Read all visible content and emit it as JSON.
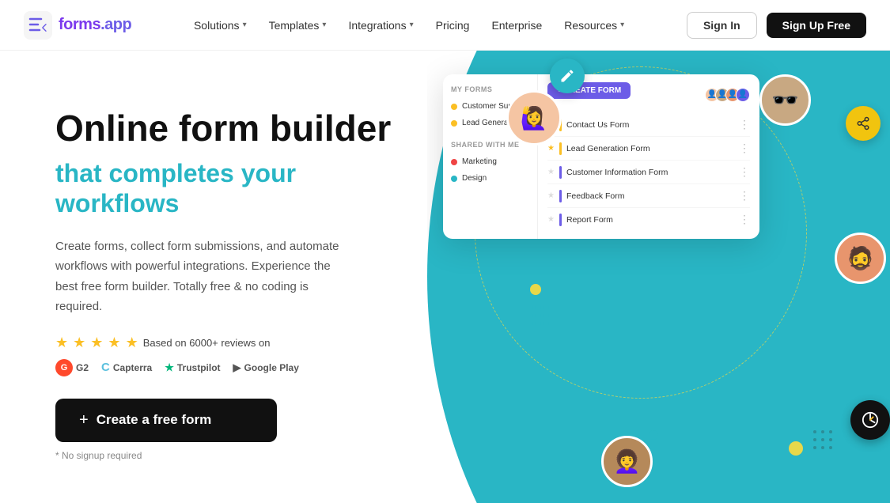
{
  "header": {
    "logo_text": "forms",
    "logo_suffix": ".app",
    "nav_items": [
      {
        "label": "Solutions",
        "has_dropdown": true
      },
      {
        "label": "Templates",
        "has_dropdown": true
      },
      {
        "label": "Integrations",
        "has_dropdown": true
      },
      {
        "label": "Pricing",
        "has_dropdown": false
      },
      {
        "label": "Enterprise",
        "has_dropdown": false
      },
      {
        "label": "Resources",
        "has_dropdown": true
      }
    ],
    "signin_label": "Sign In",
    "signup_label": "Sign Up Free"
  },
  "hero": {
    "title": "Online form builder",
    "subtitle": "that completes your workflows",
    "description": "Create forms, collect form submissions, and automate workflows with powerful integrations. Experience the best free form builder. Totally free & no coding is required.",
    "reviews_text": "Based on 6000+ reviews on",
    "cta_label": "Create a free form",
    "no_signup_note": "* No signup required"
  },
  "form_card": {
    "my_forms_label": "MY FORMS",
    "shared_label": "SHARED WITH ME",
    "sidebar_items": [
      {
        "label": "Customer Support",
        "color": "#fbbf24"
      },
      {
        "label": "Lead Generation",
        "color": "#fbbf24"
      },
      {
        "label": "Marketing",
        "color": "#ef4444"
      },
      {
        "label": "Design",
        "color": "#29b6c5"
      }
    ],
    "create_btn_label": "+ CREATE FORM",
    "form_items": [
      {
        "label": "Contact Us Form",
        "bar_color": "#fbbf24",
        "starred": true
      },
      {
        "label": "Lead Generation Form",
        "bar_color": "#fbbf24",
        "starred": true
      },
      {
        "label": "Customer Information Form",
        "bar_color": "#6c5ce7",
        "starred": false
      },
      {
        "label": "Feedback Form",
        "bar_color": "#6c5ce7",
        "starred": false
      },
      {
        "label": "Report Form",
        "bar_color": "#6c5ce7",
        "starred": false
      }
    ]
  },
  "review_platforms": [
    {
      "label": "G2",
      "type": "g2"
    },
    {
      "label": "Capterra",
      "type": "capterra"
    },
    {
      "label": "Trustpilot",
      "type": "trustpilot"
    },
    {
      "label": "Google Play",
      "type": "googleplay"
    }
  ]
}
